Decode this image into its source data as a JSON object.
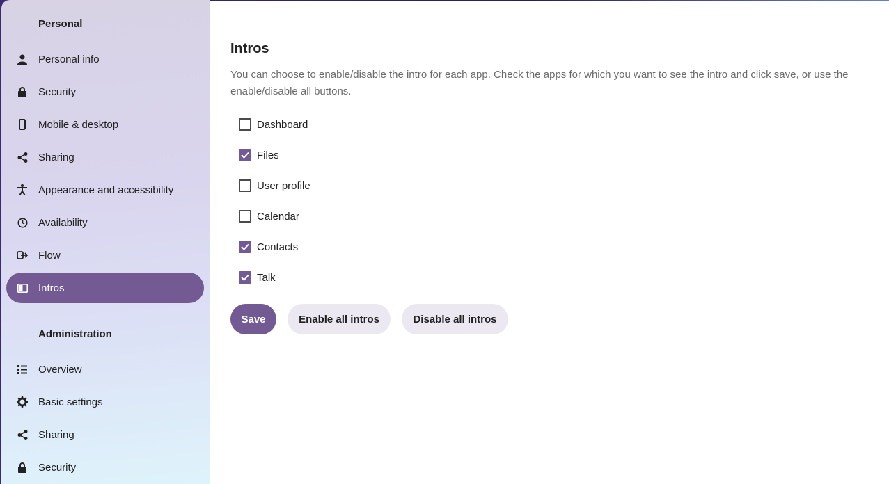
{
  "sidebar": {
    "personal_caption": "Personal",
    "personal_items": [
      {
        "label": "Personal info",
        "icon": "person-icon"
      },
      {
        "label": "Security",
        "icon": "lock-icon"
      },
      {
        "label": "Mobile & desktop",
        "icon": "phone-icon"
      },
      {
        "label": "Sharing",
        "icon": "share-icon"
      },
      {
        "label": "Appearance and accessibility",
        "icon": "accessibility-icon"
      },
      {
        "label": "Availability",
        "icon": "clock-icon"
      },
      {
        "label": "Flow",
        "icon": "flow-icon"
      },
      {
        "label": "Intros",
        "icon": "book-icon",
        "active": true
      }
    ],
    "admin_caption": "Administration",
    "admin_items": [
      {
        "label": "Overview",
        "icon": "list-icon"
      },
      {
        "label": "Basic settings",
        "icon": "gear-icon"
      },
      {
        "label": "Sharing",
        "icon": "share-icon"
      },
      {
        "label": "Security",
        "icon": "lock-icon"
      }
    ]
  },
  "main": {
    "title": "Intros",
    "description": "You can choose to enable/disable the intro for each app. Check the apps for which you want to see the intro and click save, or use the enable/disable all buttons.",
    "apps": [
      {
        "label": "Dashboard",
        "checked": false
      },
      {
        "label": "Files",
        "checked": true
      },
      {
        "label": "User profile",
        "checked": false
      },
      {
        "label": "Calendar",
        "checked": false
      },
      {
        "label": "Contacts",
        "checked": true
      },
      {
        "label": "Talk",
        "checked": true
      }
    ],
    "save_label": "Save",
    "enable_all_label": "Enable all intros",
    "disable_all_label": "Disable all intros"
  },
  "colors": {
    "accent": "#745a93",
    "secondary_button": "#ece8f2"
  }
}
